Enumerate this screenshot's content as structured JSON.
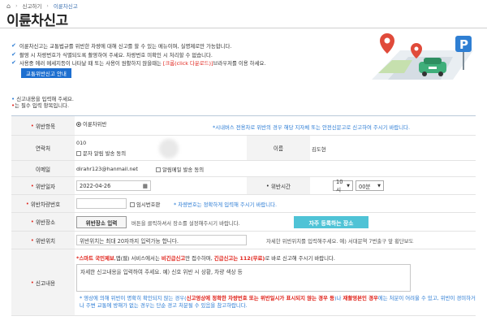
{
  "breadcrumb": {
    "home": "⌂",
    "items": [
      "신고하기",
      "이륜차신고"
    ]
  },
  "page_title": "이륜차신고",
  "notices": [
    {
      "text": "이륜차신고는 교통법규를 위반한 차량에 대해 신고를 할 수 있는 메뉴이며, 실명제로만 가능합니다."
    },
    {
      "text": "촬영 시 차량번호가 식별되도록 촬영하여 주세요. 차량번호 미확인 시 처리할 수 없습니다."
    },
    {
      "text_before": "사용중 에러 메세지등이 나타날 때 또는 사용이 원활하지 않을때는 ",
      "text_red": "[크롬(click 다운로드)]",
      "text_after": "브라우저를 이용 하세요."
    }
  ],
  "guide_button": "교통위반신고 안내",
  "hint_input": "신고내용을 입력해 주세요.",
  "hint_required": "는 필수 입력 항목입니다.",
  "form": {
    "violation_type": {
      "label": "위반항목",
      "option": "이륜차위반",
      "notice": "*시내버스 전용차로 위반의 경우 해당 지자체 또는 안전신문고로 신고하여 주시기 바랍니다."
    },
    "contact": {
      "label": "연락처",
      "value": "010",
      "sms_consent": "문자 알림 발송 동의",
      "name_label": "이름",
      "name_value": "김도현"
    },
    "email": {
      "label": "이메일",
      "value": "dirahr123@hanmail.net",
      "mail_consent": "알림메일 발송 동의"
    },
    "date": {
      "label": "위반일자",
      "value": "2022-04-26",
      "time_label": "위반시간",
      "hour": "10시",
      "minute": "00분"
    },
    "plate": {
      "label": "위반차량번호",
      "temp_plate": "임시번호판",
      "notice": "* 차량번호는 정확하게 입력해 주시기 바랍니다."
    },
    "location": {
      "label": "위반장소",
      "button": "위반장소 입력",
      "help": "버튼을 클릭하셔서 장소를 설정해주시기 바랍니다.",
      "frequent_button": "자주 등록하는 장소"
    },
    "detail_location": {
      "label": "위반위치",
      "placeholder": "위반위치는 최대 20자까지 입력가능 합니다.",
      "help": "자세한 위반위치를 입력해주세요. 예) 서대문역 7번출구 앞 횡단보도"
    },
    "content": {
      "label": "신고내용",
      "top_red1": "*스마트 국민제보",
      "top_mid1": ",앱(웹) 서비스에서는 ",
      "top_red2": "비긴급신고",
      "top_mid2": "만 접수하며, ",
      "top_red3": "긴급신고는 112(무료)",
      "top_end": "로 바로 신고해 주시기 바랍니다.",
      "placeholder": "자세한 신고내용을 입력하여 주세요. 예) 신호 위반 시 상황, 차량 색상 등",
      "bottom_before": "* 영상에 의해 위반이 명확히 확인되지 않는 경우(",
      "bottom_red1": "신고영상에 정확한 차량번호 또는 위반일시가 표시되지 않는 경우 등",
      "bottom_mid": ")나 ",
      "bottom_red2": "재촬영본인 경우",
      "bottom_after": "에는 처분이 어려울 수 있고, 위반이 경미하거나 주변 교통에 방해가 없는 경우는 단순 경고 처분될 수 있음을 참고하랍니다."
    }
  },
  "colors": {
    "accent": "#1d6fd0",
    "required": "#e0221a",
    "teal": "#4fc3d6"
  }
}
